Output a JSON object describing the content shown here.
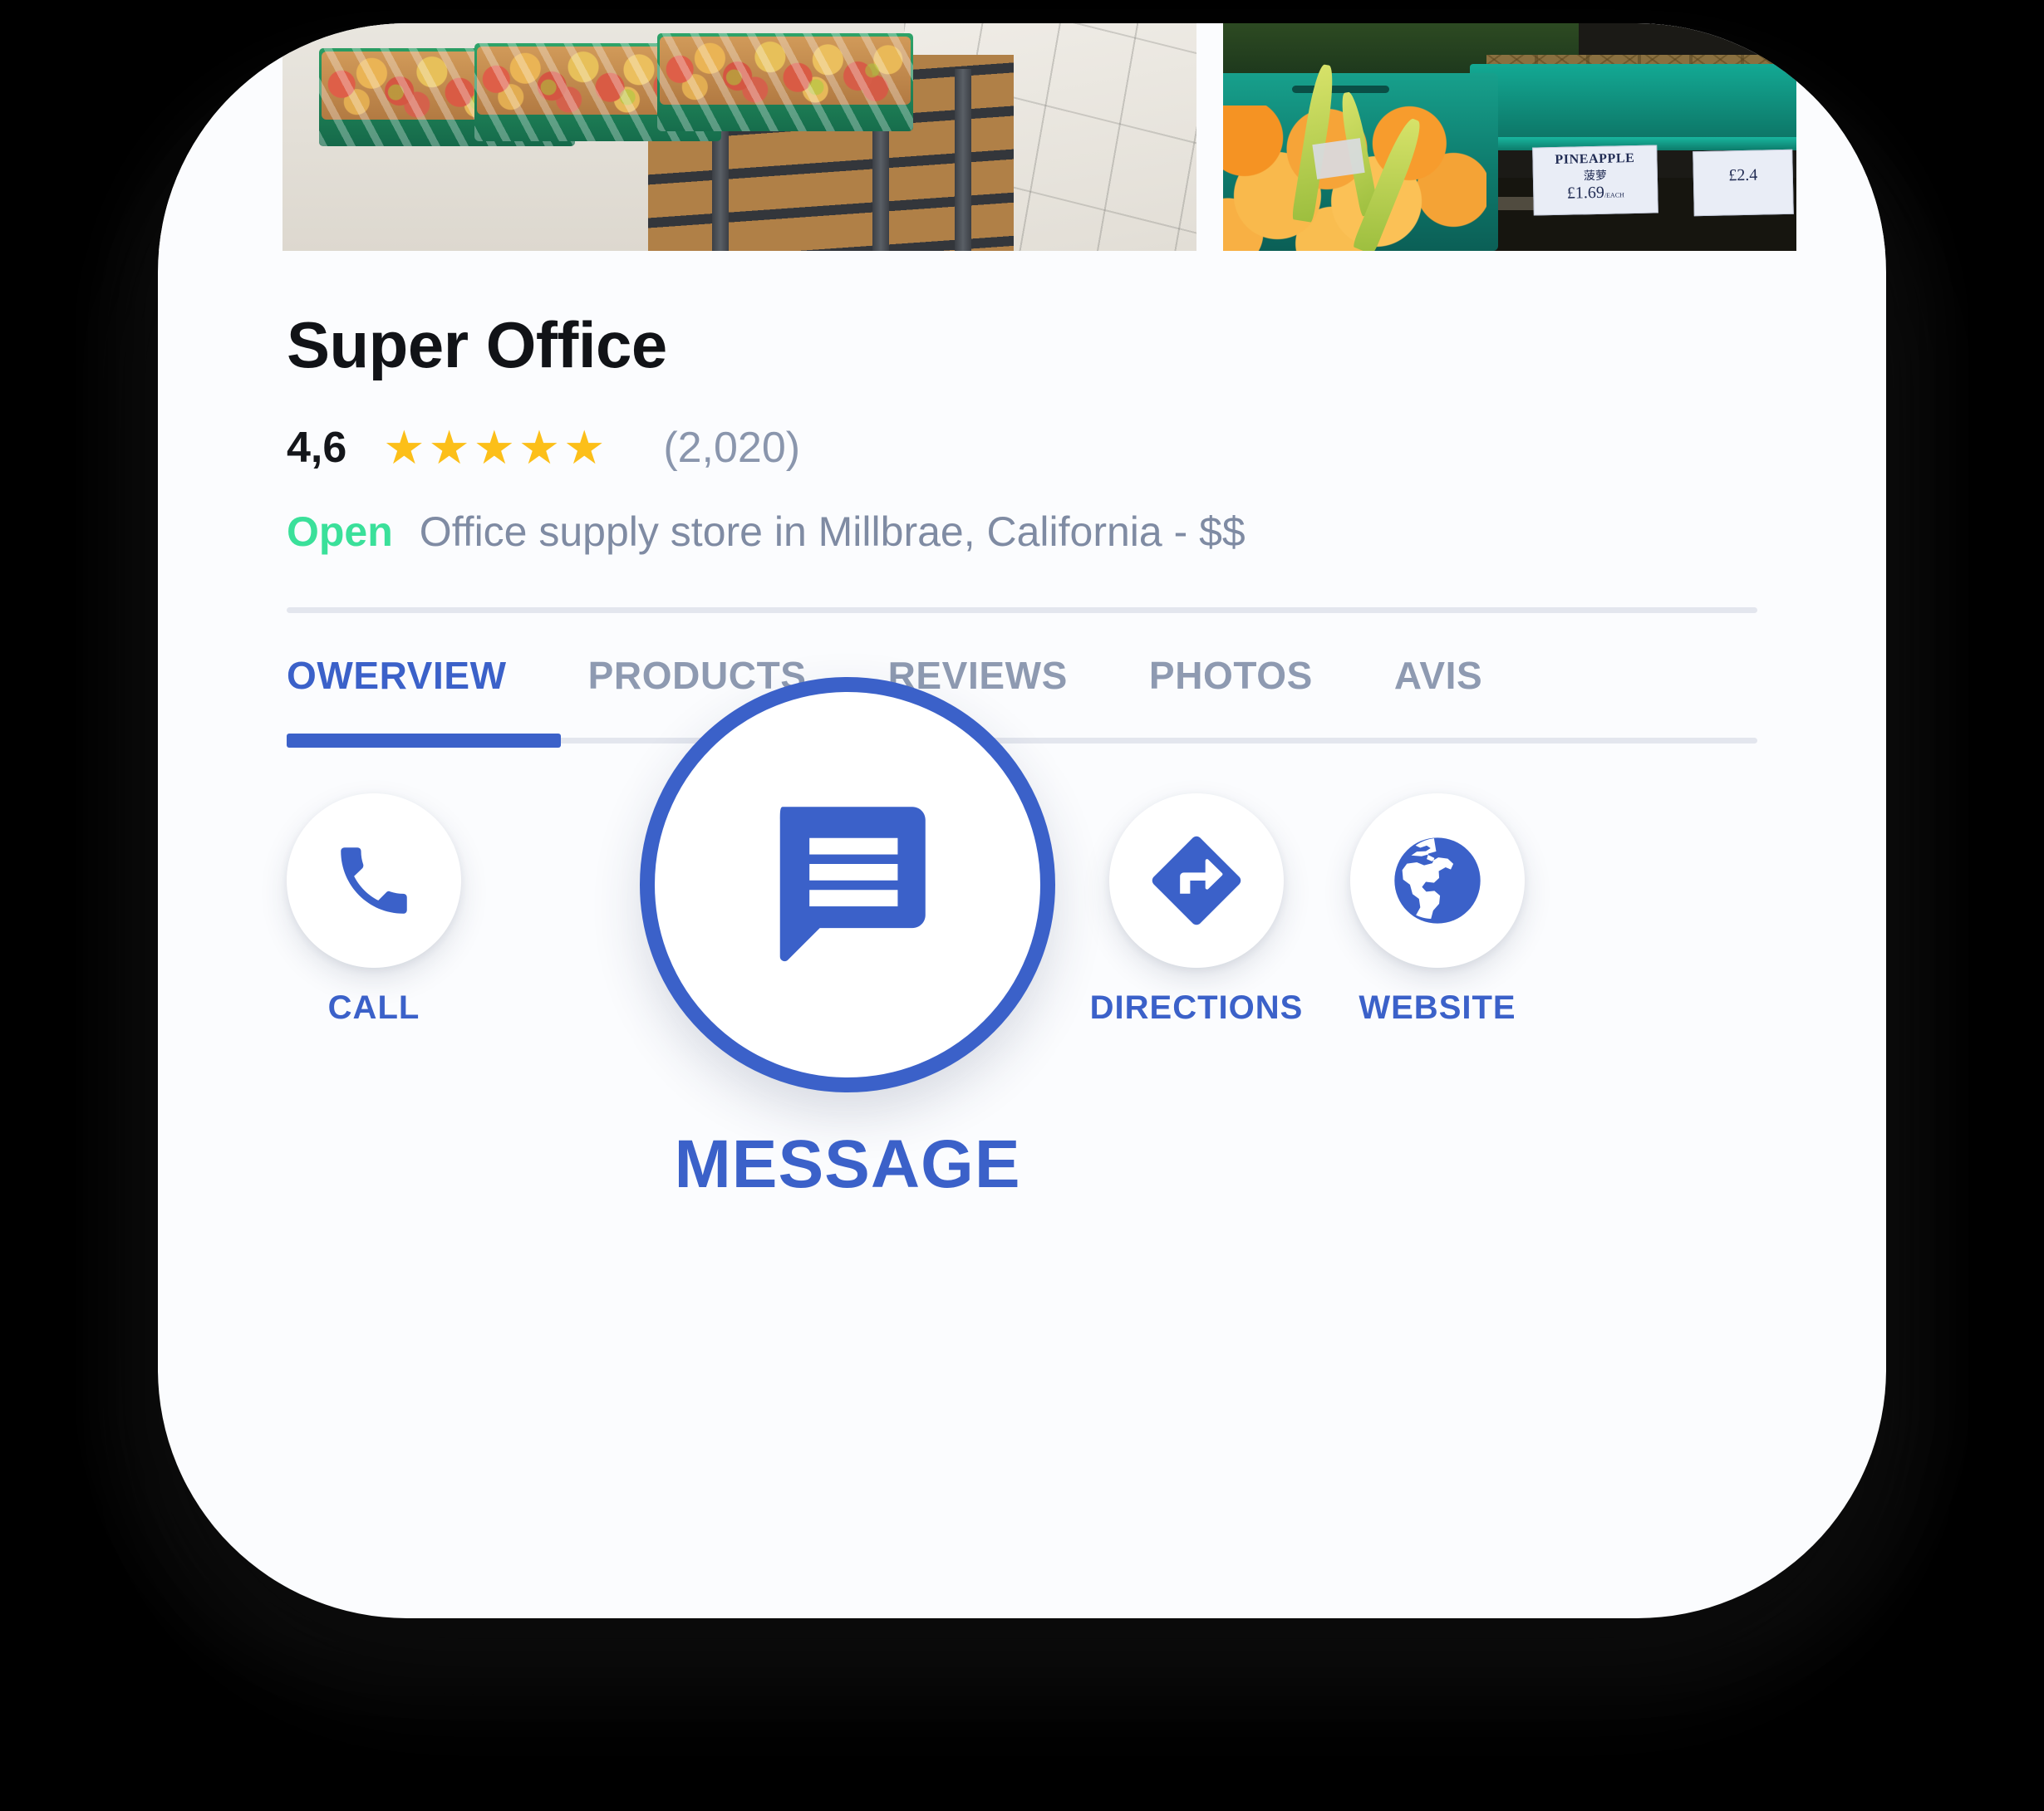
{
  "business": {
    "name": "Super Office",
    "rating_value": "4,6",
    "stars_filled": 5,
    "star_glyph": "★",
    "review_count": "(2,020)",
    "status": "Open",
    "description": "Office supply store in Millbrae, California - $$"
  },
  "tabs": [
    {
      "label": "OWERVIEW",
      "active": true
    },
    {
      "label": "PRODUCTS",
      "active": false
    },
    {
      "label": "REVIEWS",
      "active": false
    },
    {
      "label": "PHOTOS",
      "active": false
    },
    {
      "label": "AVIS",
      "active": false
    }
  ],
  "actions": {
    "call": {
      "label": "CALL",
      "icon": "phone-icon"
    },
    "message": {
      "label": "MESSAGE",
      "icon": "chat-bubble-icon"
    },
    "directions": {
      "label": "DIRECTIONS",
      "icon": "directions-diamond-icon"
    },
    "website": {
      "label": "WEBSITE",
      "icon": "globe-icon"
    }
  },
  "photos": [
    {
      "alt": "apples-in-green-crates-on-wooden-display"
    },
    {
      "alt": "oranges-and-pineapples-in-teal-crates",
      "sign_1_title": "PINEAPPLE",
      "sign_1_subtitle": "菠萝",
      "sign_1_price": "£1.69",
      "sign_1_unit": "/EACH",
      "sign_2_price": "£2.4"
    }
  ],
  "colors": {
    "accent_blue": "#3B61C9",
    "star_gold": "#FCBF19",
    "open_green": "#3AE09A",
    "muted_text": "#8a96ad",
    "card_bg": "#fbfcfe",
    "divider": "#e3e6ee"
  }
}
